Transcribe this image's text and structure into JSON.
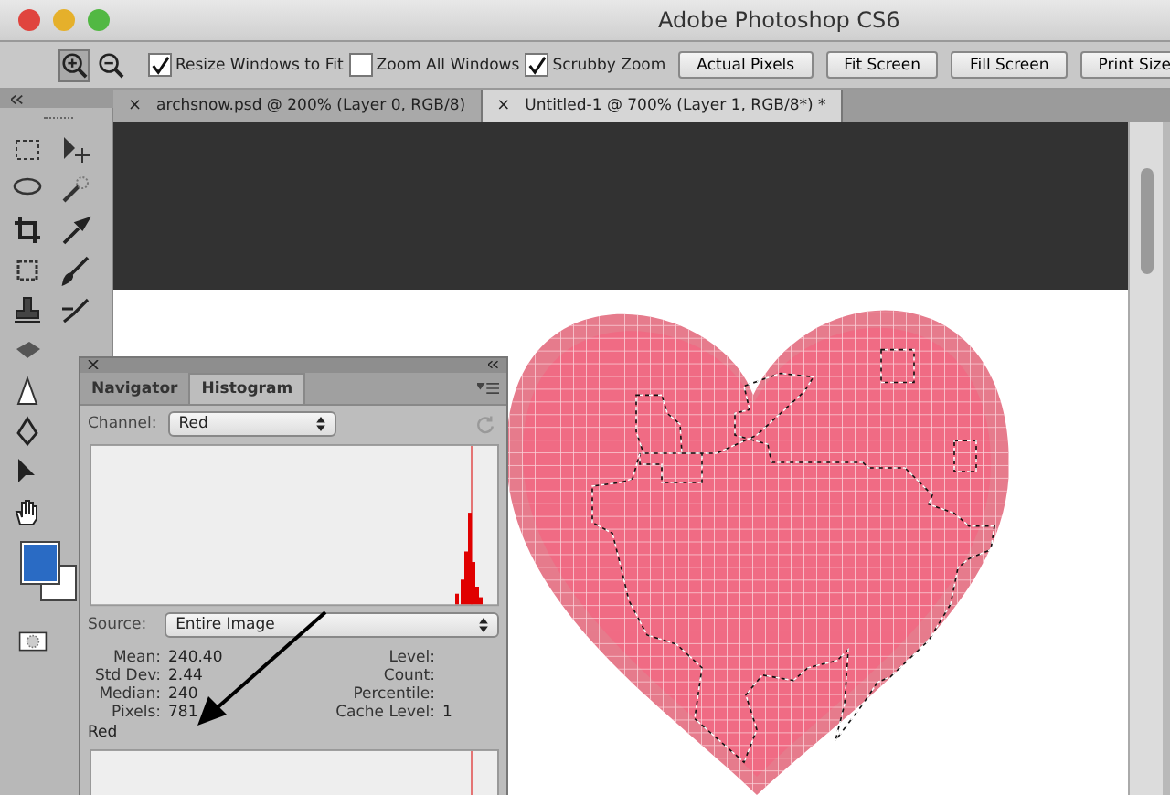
{
  "window": {
    "title": "Adobe Photoshop CS6"
  },
  "options_bar": {
    "zoom_modes": [
      {
        "kind": "zoom-in",
        "selected": true
      },
      {
        "kind": "zoom-out",
        "selected": false
      }
    ],
    "checkboxes": [
      {
        "label": "Resize Windows to Fit",
        "checked": true
      },
      {
        "label": "Zoom All Windows",
        "checked": false
      },
      {
        "label": "Scrubby Zoom",
        "checked": true
      }
    ],
    "buttons": [
      "Actual Pixels",
      "Fit Screen",
      "Fill Screen",
      "Print Size"
    ]
  },
  "document_tabs": [
    {
      "close": "×",
      "label": "archsnow.psd @ 200% (Layer 0, RGB/8)",
      "selected": false
    },
    {
      "close": "×",
      "label": "Untitled-1 @ 700% (Layer 1, RGB/8*) *",
      "selected": true
    }
  ],
  "histogram_panel": {
    "tabs": [
      {
        "label": "Navigator",
        "selected": false
      },
      {
        "label": "Histogram",
        "selected": true
      }
    ],
    "channel": {
      "label": "Channel:",
      "value": "Red"
    },
    "source": {
      "label": "Source:",
      "value": "Entire Image"
    },
    "stats_left": [
      {
        "label": "Mean:",
        "value": "240.40"
      },
      {
        "label": "Std Dev:",
        "value": "2.44"
      },
      {
        "label": "Median:",
        "value": "240"
      },
      {
        "label": "Pixels:",
        "value": "781"
      }
    ],
    "stats_right": [
      {
        "label": "Level:"
      },
      {
        "label": "Count:"
      },
      {
        "label": "Percentile:"
      },
      {
        "label": "Cache Level:",
        "value": "1"
      }
    ],
    "channel_caption": "Red"
  }
}
